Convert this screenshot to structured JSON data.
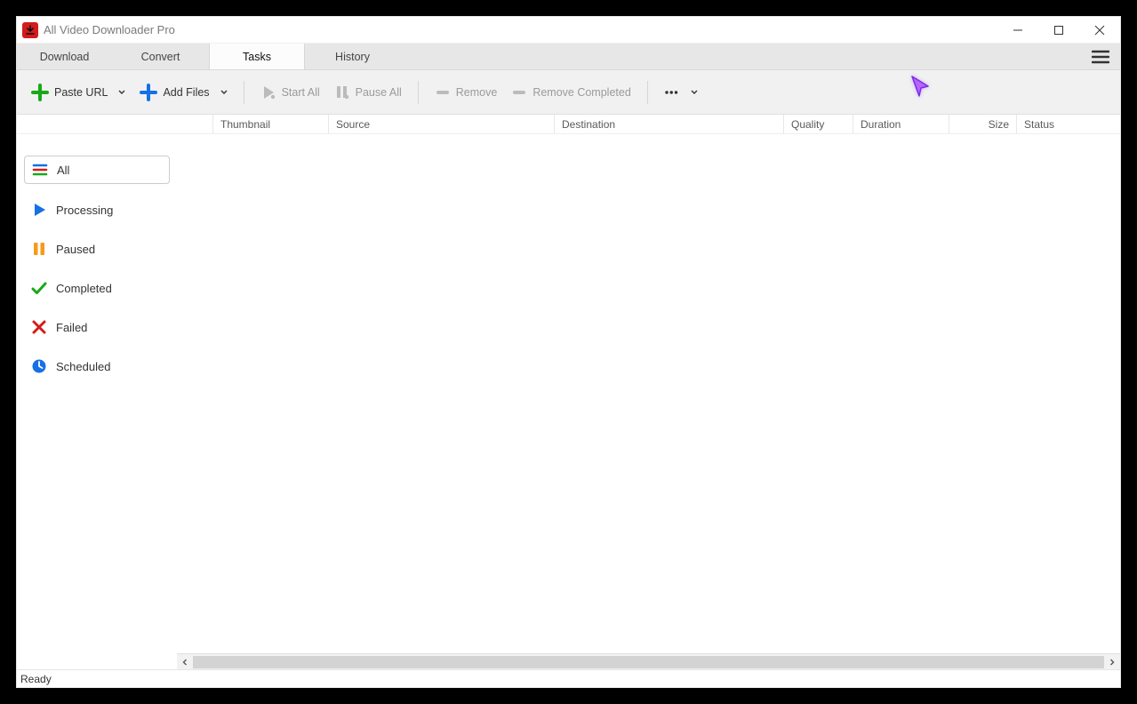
{
  "title": "All Video Downloader Pro",
  "tabs": {
    "download": "Download",
    "convert": "Convert",
    "tasks": "Tasks",
    "history": "History"
  },
  "active_tab": "tasks",
  "toolbar": {
    "paste_url": "Paste URL",
    "add_files": "Add Files",
    "start_all": "Start All",
    "pause_all": "Pause All",
    "remove": "Remove",
    "remove_completed": "Remove Completed"
  },
  "sidebar": {
    "all": "All",
    "processing": "Processing",
    "paused": "Paused",
    "completed": "Completed",
    "failed": "Failed",
    "scheduled": "Scheduled"
  },
  "active_filter": "all",
  "columns": {
    "thumbnail": "Thumbnail",
    "source": "Source",
    "destination": "Destination",
    "quality": "Quality",
    "duration": "Duration",
    "size": "Size",
    "status": "Status"
  },
  "rows": [],
  "status_text": "Ready"
}
